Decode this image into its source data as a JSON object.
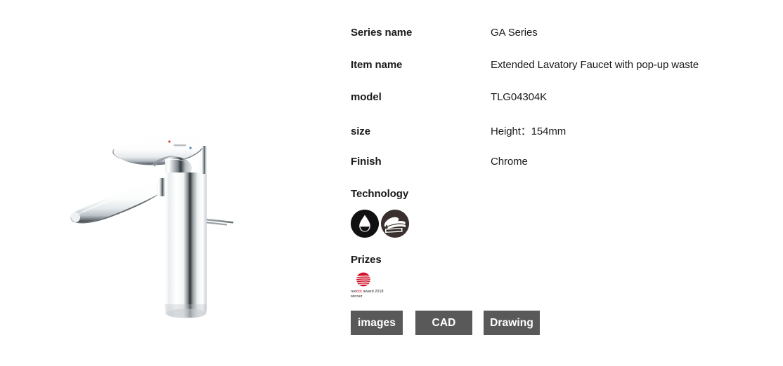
{
  "product_image": {
    "name": "faucet-product-photo",
    "alt": "Chrome extended single-lever lavatory faucet with pop-up waste lift rod",
    "finish_color": "#d8dcdf"
  },
  "spec_rows": [
    {
      "label": "Series name",
      "value": "GA Series"
    },
    {
      "label": "Item name",
      "value": "Extended Lavatory Faucet with pop-up waste"
    },
    {
      "label": "model",
      "value": "TLG04304K"
    },
    {
      "label": "size",
      "value": "Height：154mm"
    },
    {
      "label": "Finish",
      "value": "Chrome"
    }
  ],
  "technology": {
    "heading": "Technology",
    "icons": [
      {
        "name": "water-drop-ecology-icon",
        "label": "Water saving",
        "color": "#111111"
      },
      {
        "name": "easy-care-wipe-icon",
        "label": "Easy care surface",
        "color": "#3a312e"
      }
    ]
  },
  "prizes": {
    "heading": "Prizes",
    "items": [
      {
        "name": "reddot-award-badge",
        "logo_color": "#d2112b",
        "caption_part1": "red",
        "caption_part2": "dot",
        "caption_part3": " award 2018",
        "caption_line2": "winner"
      }
    ]
  },
  "buttons": [
    {
      "label": "images",
      "name": "images-button"
    },
    {
      "label": "CAD",
      "name": "cad-button"
    },
    {
      "label": "Drawing",
      "name": "drawing-button"
    }
  ],
  "theme": {
    "page_bg": "#ffffff",
    "text_color": "#1b1b1b",
    "button_bg": "#595959",
    "button_text": "#ffffff"
  }
}
